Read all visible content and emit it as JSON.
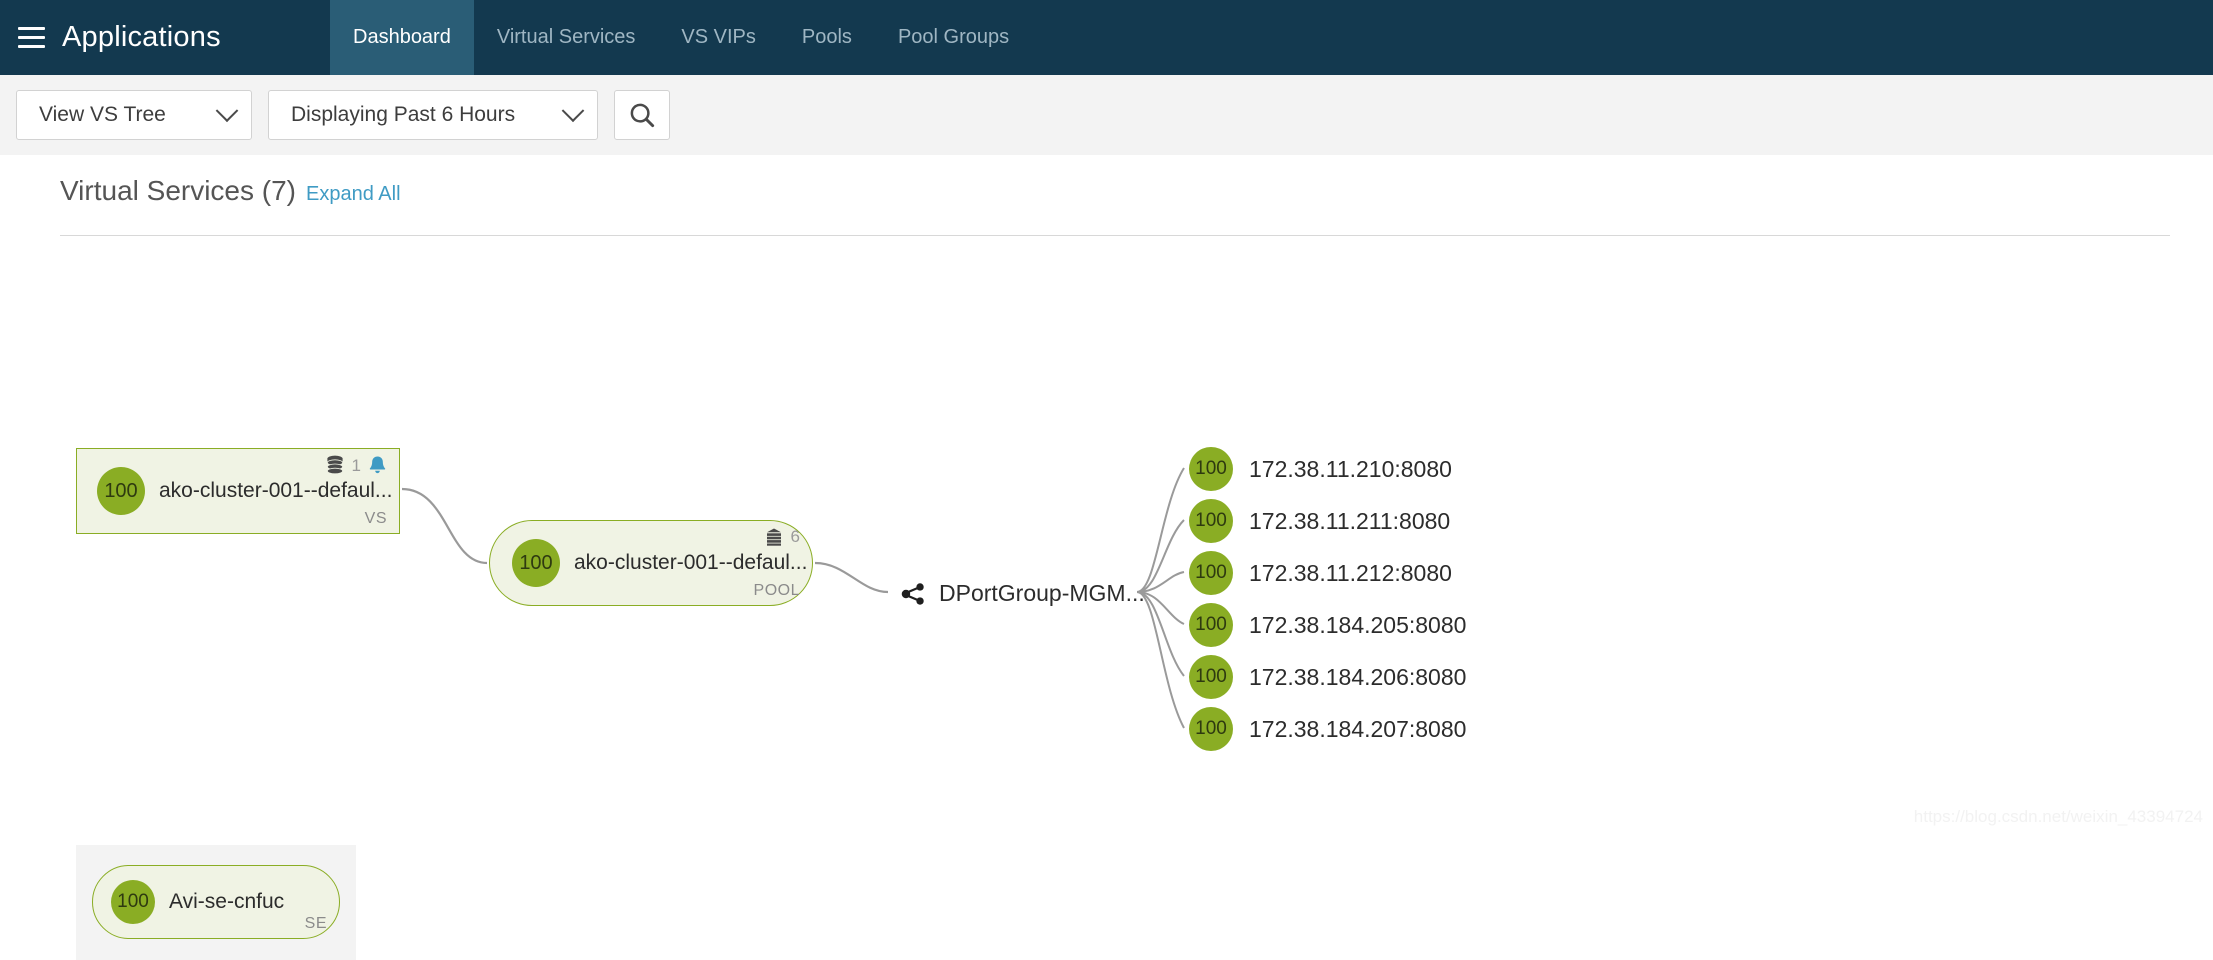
{
  "header": {
    "menu_icon": "hamburger-icon",
    "brand": "Applications",
    "tabs": [
      {
        "label": "Dashboard",
        "active": true
      },
      {
        "label": "Virtual Services",
        "active": false
      },
      {
        "label": "VS VIPs",
        "active": false
      },
      {
        "label": "Pools",
        "active": false
      },
      {
        "label": "Pool Groups",
        "active": false
      }
    ],
    "bg_color": "#13394f",
    "active_tab_color": "#2a5d76"
  },
  "toolbar": {
    "view_select": "View VS Tree",
    "time_select": "Displaying  Past 6 Hours",
    "search_icon": "search-icon"
  },
  "panel": {
    "title": "Virtual Services (7)",
    "expand_all": "Expand All",
    "link_color": "#3f9bc4"
  },
  "tree": {
    "accent_green": "#8aad24",
    "node_bg": "#f0f3e4",
    "vs": {
      "score": "100",
      "label": "ako-cluster-001--defaul...",
      "type": "VS",
      "meta_icon": "database-icon",
      "meta_count": "1",
      "alert_icon": "bell-icon"
    },
    "pool": {
      "score": "100",
      "label": "ako-cluster-001--defaul...",
      "type": "POOL",
      "meta_icon": "server-rack-icon",
      "meta_count": "6"
    },
    "portgroup": {
      "icon": "share-network-icon",
      "label": "DPortGroup-MGM..."
    },
    "servers": [
      {
        "score": "100",
        "label": "172.38.11.210:8080"
      },
      {
        "score": "100",
        "label": "172.38.11.211:8080"
      },
      {
        "score": "100",
        "label": "172.38.11.212:8080"
      },
      {
        "score": "100",
        "label": "172.38.184.205:8080"
      },
      {
        "score": "100",
        "label": "172.38.184.206:8080"
      },
      {
        "score": "100",
        "label": "172.38.184.207:8080"
      }
    ],
    "se": {
      "score": "100",
      "label": "Avi-se-cnfuc",
      "type": "SE"
    }
  },
  "watermark": "https://blog.csdn.net/weixin_43394724"
}
